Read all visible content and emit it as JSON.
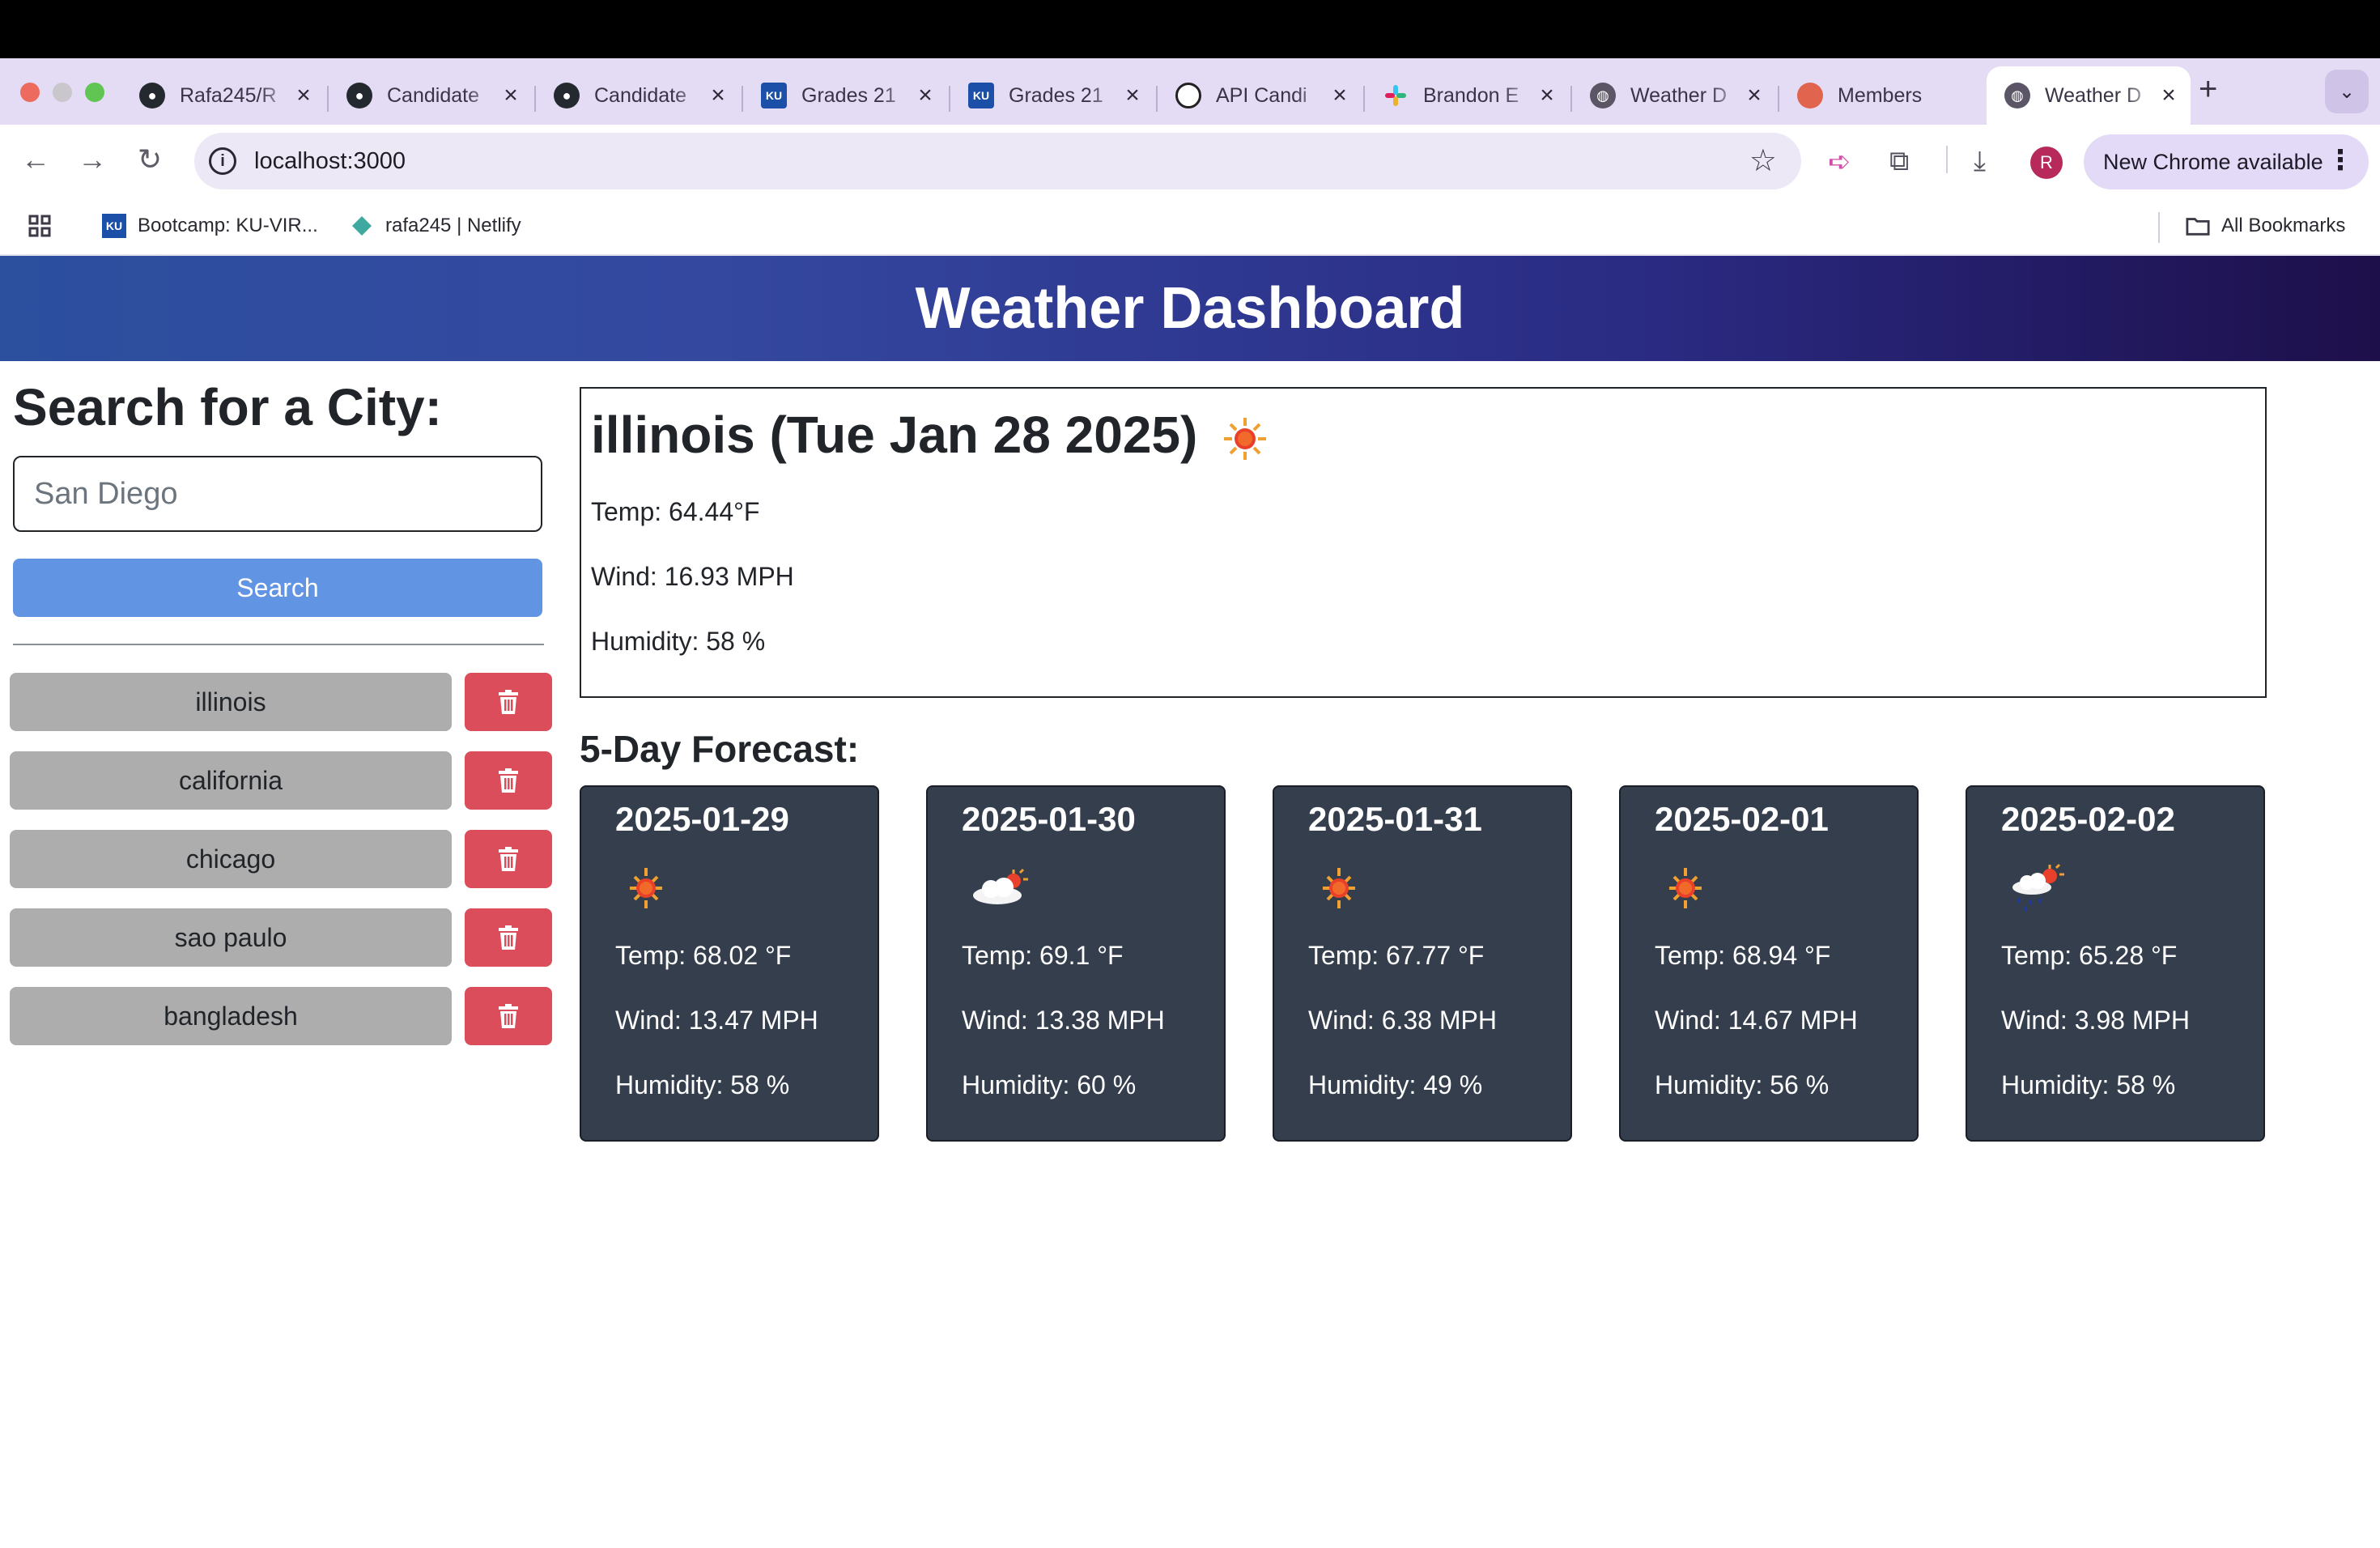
{
  "browser": {
    "tabs": [
      {
        "label": "Rafa245/R",
        "icon": "github-icon"
      },
      {
        "label": "Candidate",
        "icon": "github-icon"
      },
      {
        "label": "Candidate",
        "icon": "github-icon"
      },
      {
        "label": "Grades 21",
        "icon": "ku-icon"
      },
      {
        "label": "Grades 21",
        "icon": "ku-icon"
      },
      {
        "label": "API Candi",
        "icon": "openai-icon"
      },
      {
        "label": "Brandon E",
        "icon": "slack-icon"
      },
      {
        "label": "Weather D",
        "icon": "globe-icon"
      },
      {
        "label": "Members",
        "icon": "members-icon"
      },
      {
        "label": "Weather D",
        "icon": "globe-icon",
        "active": true
      }
    ],
    "url": "localhost:3000",
    "avatar_letter": "R",
    "update_label": "New Chrome available",
    "bookmarks": [
      {
        "label": "Bootcamp: KU-VIR...",
        "icon": "ku-icon"
      },
      {
        "label": "rafa245 | Netlify",
        "icon": "netlify-icon"
      }
    ],
    "all_bookmarks_label": "All Bookmarks"
  },
  "page": {
    "title": "Weather Dashboard",
    "search": {
      "heading": "Search for a City:",
      "placeholder": "San Diego",
      "button_label": "Search"
    },
    "history": [
      "illinois",
      "california",
      "chicago",
      "sao paulo",
      "bangladesh"
    ],
    "today": {
      "title": "illinois (Tue Jan 28 2025)",
      "icon": "sun-icon",
      "temp": "Temp: 64.44°F",
      "wind": "Wind: 16.93 MPH",
      "humidity": "Humidity: 58 %"
    },
    "forecast_heading": "5-Day Forecast:",
    "forecast": [
      {
        "date": "2025-01-29",
        "icon": "sun-icon",
        "temp": "Temp: 68.02 °F",
        "wind": "Wind: 13.47 MPH",
        "humidity": "Humidity: 58 %"
      },
      {
        "date": "2025-01-30",
        "icon": "partly-cloudy-icon",
        "temp": "Temp: 69.1 °F",
        "wind": "Wind: 13.38 MPH",
        "humidity": "Humidity: 60 %"
      },
      {
        "date": "2025-01-31",
        "icon": "sun-icon",
        "temp": "Temp: 67.77 °F",
        "wind": "Wind: 6.38 MPH",
        "humidity": "Humidity: 49 %"
      },
      {
        "date": "2025-02-01",
        "icon": "sun-icon",
        "temp": "Temp: 68.94 °F",
        "wind": "Wind: 14.67 MPH",
        "humidity": "Humidity: 56 %"
      },
      {
        "date": "2025-02-02",
        "icon": "rain-sun-icon",
        "temp": "Temp: 65.28 °F",
        "wind": "Wind: 3.98 MPH",
        "humidity": "Humidity: 58 %"
      }
    ],
    "colors": {
      "header_start": "#2c4f9e",
      "header_end": "#1d0f4a",
      "search_button": "#6194e2",
      "history_button": "#adadad",
      "delete_button": "#dc4d5c",
      "forecast_card": "#343e4d"
    }
  }
}
